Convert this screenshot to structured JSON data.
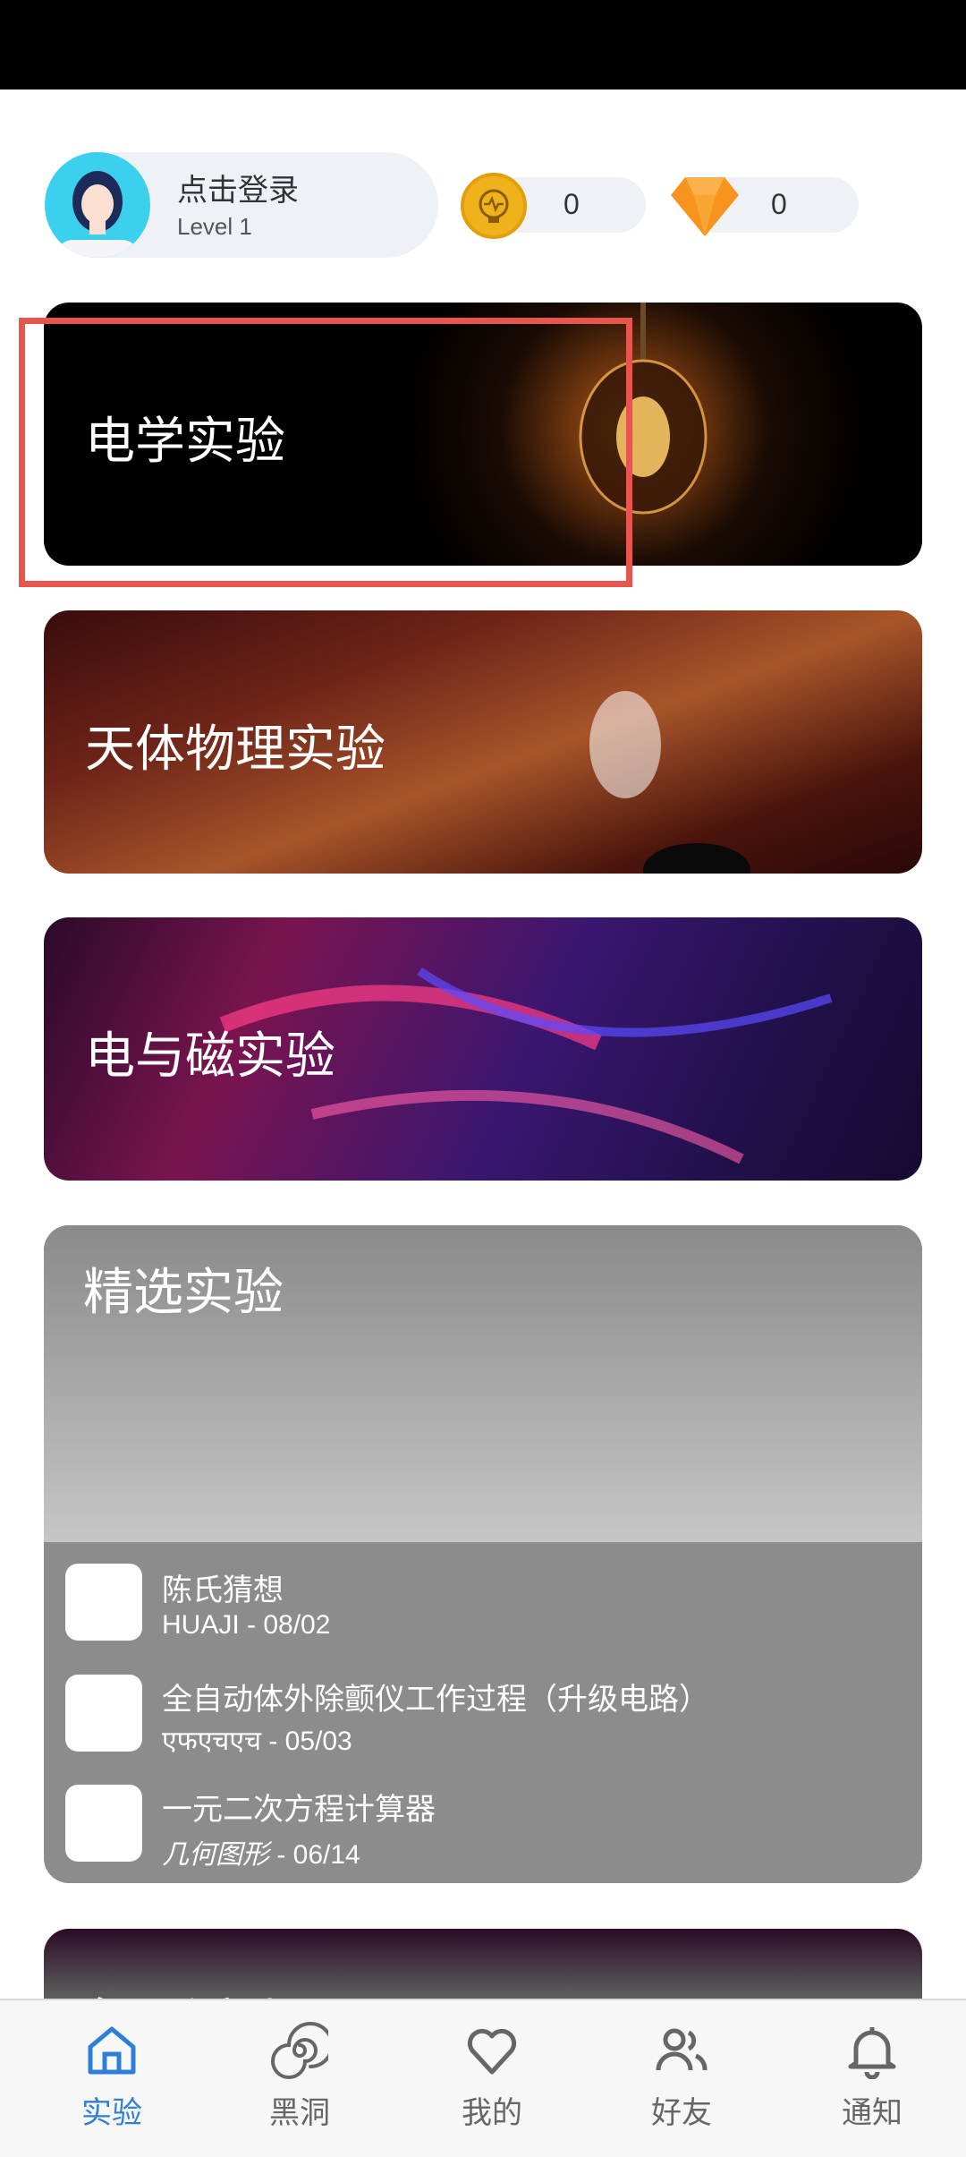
{
  "header": {
    "login_text": "点击登录",
    "level": "Level 1",
    "coins": "0",
    "gems": "0"
  },
  "categories": [
    {
      "title": "电学实验"
    },
    {
      "title": "天体物理实验"
    },
    {
      "title": "电与磁实验"
    }
  ],
  "featured": {
    "title": "精选实验",
    "items": [
      {
        "title": "陈氏猜想",
        "author": "HUAJI",
        "date": " - 08/02"
      },
      {
        "title": "全自动体外除颤仪工作过程（升级电路）",
        "author": "एफएचएच",
        "date": " - 05/03"
      },
      {
        "title": "一元二次方程计算器",
        "author": "几何图形",
        "date": " - 06/14"
      }
    ]
  },
  "next_card": {
    "title": "每日活动"
  },
  "tabs": [
    {
      "label": "实验",
      "icon": "home-icon",
      "active": true
    },
    {
      "label": "黑洞",
      "icon": "black-hole-icon"
    },
    {
      "label": "我的",
      "icon": "heart-icon"
    },
    {
      "label": "好友",
      "icon": "friends-icon"
    },
    {
      "label": "通知",
      "icon": "bell-icon"
    }
  ],
  "colors": {
    "accent": "#2f7fd6",
    "highlight_box": "#e8554e"
  }
}
